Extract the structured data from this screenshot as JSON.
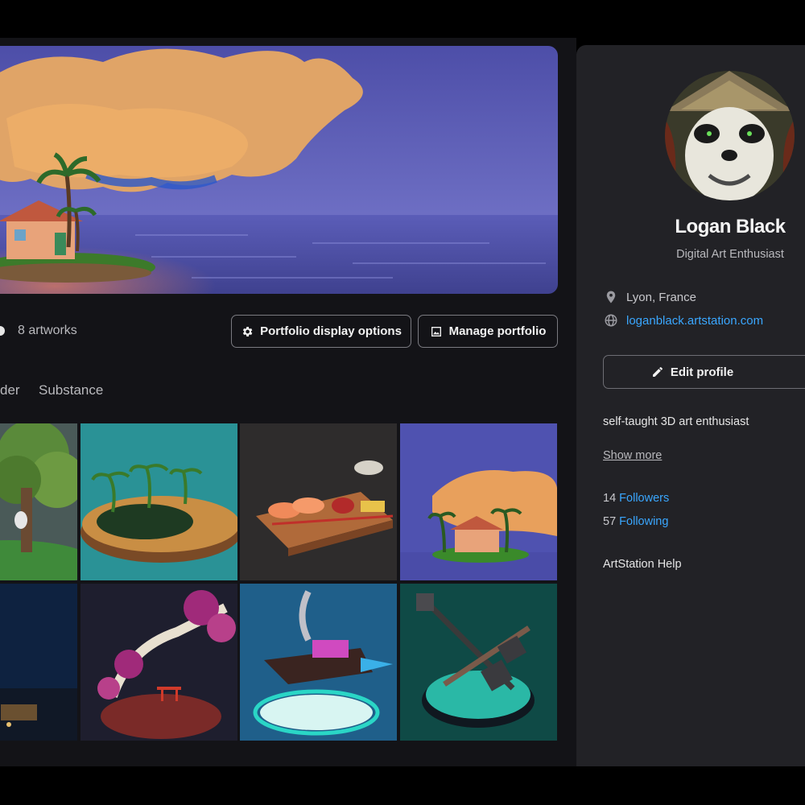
{
  "header": {},
  "cover": {
    "alt_icon": "island-cover-image"
  },
  "portfolio": {
    "artworks_count": "8 artworks",
    "display_options_label": "Portfolio display options",
    "manage_label": "Manage portfolio"
  },
  "tabs": [
    {
      "label": "der"
    },
    {
      "label": "Substance"
    }
  ],
  "grid": [
    {
      "subject": "tree-scene"
    },
    {
      "subject": "palm-island-platform"
    },
    {
      "subject": "sushi-board"
    },
    {
      "subject": "island-house"
    },
    {
      "subject": "night-scene"
    },
    {
      "subject": "torii-cherry-tree"
    },
    {
      "subject": "flying-ship"
    },
    {
      "subject": "crossed-hammers"
    }
  ],
  "profile": {
    "name": "Logan Black",
    "headline": "Digital Art Enthusiast",
    "location": "Lyon, France",
    "website": "loganblack.artstation.com",
    "edit_label": "Edit profile",
    "bio": "self-taught 3D art enthusiast",
    "show_more": "Show more",
    "followers_count": "14",
    "followers_label": "Followers",
    "following_count": "57",
    "following_label": "Following",
    "help": "ArtStation Help"
  },
  "colors": {
    "background": "#131317",
    "sidebar": "#222226",
    "link": "#3aa7ff",
    "button_border": "#7a7a80"
  }
}
